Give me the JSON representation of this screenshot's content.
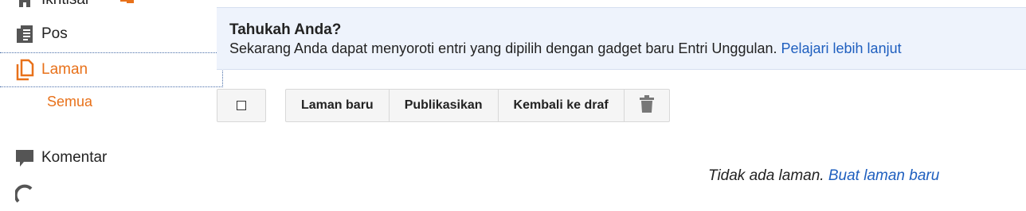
{
  "sidebar": {
    "items": [
      {
        "label": "Ikhtisar",
        "icon": "home-icon"
      },
      {
        "label": "Pos",
        "icon": "posts-icon"
      },
      {
        "label": "Laman",
        "icon": "pages-icon",
        "active": true
      },
      {
        "label": "Komentar",
        "icon": "comment-icon"
      }
    ],
    "subitems": [
      {
        "label": "Semua"
      }
    ]
  },
  "banner": {
    "title": "Tahukah Anda?",
    "text": "Sekarang Anda dapat menyoroti entri yang dipilih dengan gadget baru Entri Unggulan.",
    "link": "Pelajari lebih lanjut"
  },
  "toolbar": {
    "new_page": "Laman baru",
    "publish": "Publikasikan",
    "revert": "Kembali ke draf",
    "delete_icon": "trash-icon"
  },
  "empty_state": {
    "text": "Tidak ada laman.",
    "link": "Buat laman baru"
  },
  "colors": {
    "accent": "#e8711a",
    "link": "#1f5fbf",
    "banner_bg": "#eef3fc",
    "icon_gray": "#555555"
  }
}
